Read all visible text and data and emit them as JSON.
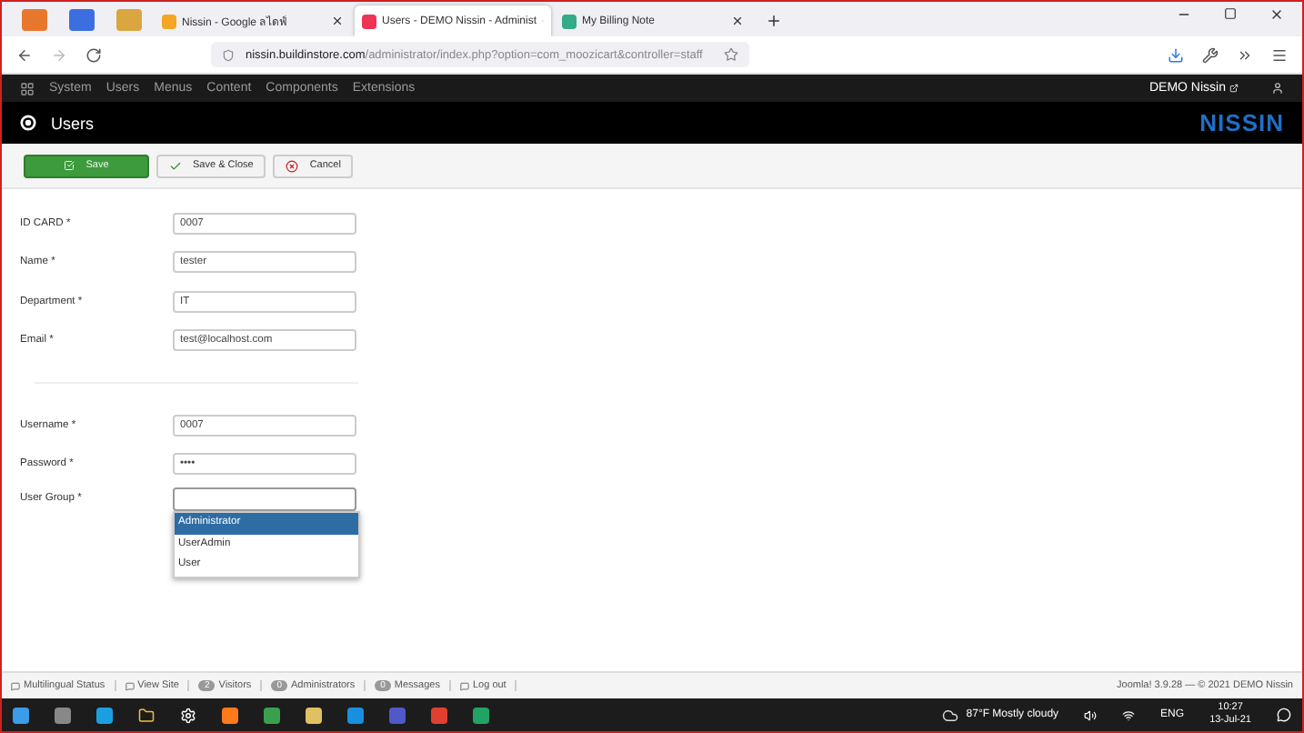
{
  "browser_tabs": [
    {
      "label": "Nissin - Google ลไดฟ์",
      "selected": false
    },
    {
      "label": "Users - DEMO Nissin - Administ",
      "selected": true
    },
    {
      "label": "My Billing Note",
      "selected": false
    }
  ],
  "url": {
    "domain": "nissin.buildinstore.com",
    "path": "/administrator/index.php?option=com_moozicart&controller=staff"
  },
  "menu": [
    "System",
    "Users",
    "Menus",
    "Content",
    "Components",
    "Extensions"
  ],
  "site_link": "DEMO Nissin",
  "page_title": "Users",
  "logo": "NISSIN",
  "toolbar": [
    {
      "kind": "primary",
      "label": "Save"
    },
    {
      "kind": "check",
      "label": "Save & Close"
    },
    {
      "kind": "cancel",
      "label": "Cancel"
    }
  ],
  "fields_top": [
    {
      "label": "ID CARD *",
      "value": "0007"
    },
    {
      "label": "Name *",
      "value": "tester"
    },
    {
      "label": "Department *",
      "value": "IT"
    },
    {
      "label": "Email *",
      "value": "test@localhost.com"
    }
  ],
  "fields_bottom": [
    {
      "label": "Username *",
      "value": "0007"
    },
    {
      "label": "Password *",
      "value": "••••"
    }
  ],
  "user_group": {
    "label": "User Group *",
    "options": [
      {
        "label": "Administrator",
        "selected": true
      },
      {
        "label": "UserAdmin",
        "selected": false
      },
      {
        "label": "User",
        "selected": false
      }
    ]
  },
  "status_bar": [
    {
      "kind": "icon",
      "label": "Multilingual Status"
    },
    {
      "kind": "icon",
      "label": "View Site"
    },
    {
      "kind": "count",
      "count": "2",
      "label": "Visitors"
    },
    {
      "kind": "count",
      "count": "0",
      "label": "Administrators"
    },
    {
      "kind": "count",
      "count": "0",
      "label": "Messages"
    },
    {
      "kind": "icon",
      "label": "Log out"
    }
  ],
  "footer": "Joomla! 3.9.28 — © 2021 DEMO Nissin",
  "taskbar": {
    "weather": "87°F  Mostly cloudy",
    "language": "ENG",
    "time": "10:27",
    "date": "13-Jul-21"
  }
}
